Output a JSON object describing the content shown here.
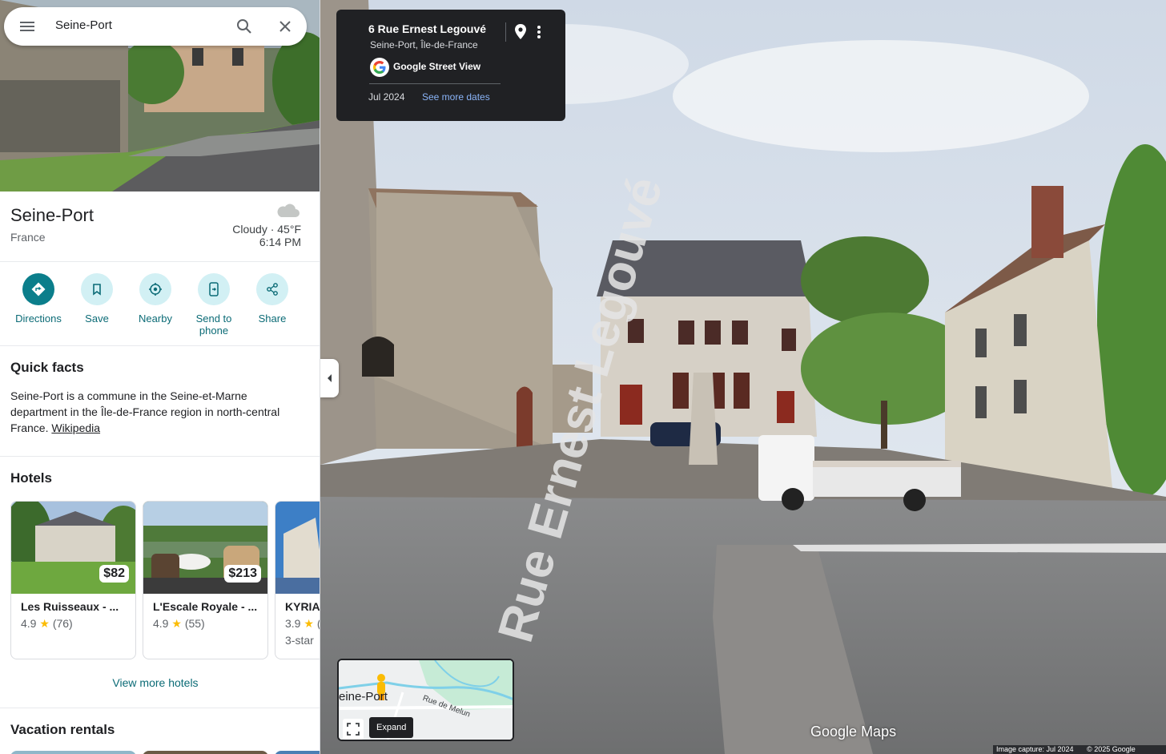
{
  "search": {
    "query": "Seine-Port"
  },
  "place": {
    "name": "Seine-Port",
    "country": "France",
    "weather": {
      "condition_temp": "Cloudy · 45°F",
      "time": "6:14 PM",
      "icon": "cloud-icon"
    }
  },
  "actions": [
    {
      "label": "Directions",
      "icon": "directions-icon"
    },
    {
      "label": "Save",
      "icon": "bookmark-icon"
    },
    {
      "label": "Nearby",
      "icon": "nearby-icon"
    },
    {
      "label": "Send to",
      "label2": "phone",
      "icon": "send-to-phone-icon"
    },
    {
      "label": "Share",
      "icon": "share-icon"
    }
  ],
  "quick_facts": {
    "title": "Quick facts",
    "text": "Seine-Port is a commune in the Seine-et-Marne department in the Île-de-France region in north-central France.",
    "link": "Wikipedia"
  },
  "hotels": {
    "title": "Hotels",
    "items": [
      {
        "name": "Les Ruisseaux - ...",
        "rating": "4.9",
        "reviews": "(76)",
        "price": "$82",
        "class": ""
      },
      {
        "name": "L'Escale Royale - ...",
        "rating": "4.9",
        "reviews": "(55)",
        "price": "$213",
        "class": ""
      },
      {
        "name": "KYRIAD",
        "rating": "3.9",
        "reviews": "(",
        "price": "",
        "class": "3-star"
      }
    ],
    "view_more": "View more hotels"
  },
  "vacation_rentals": {
    "title": "Vacation rentals"
  },
  "street_view": {
    "address": "6 Rue Ernest Legouvé",
    "locality": "Seine-Port, Île-de-France",
    "provider": "Google Street View",
    "date": "Jul 2024",
    "more_dates": "See more dates",
    "street_label": "Rue Ernest Legouvé"
  },
  "minimap": {
    "place": "eine-Port",
    "road": "Rue de Melun",
    "expand_tip": "Expand"
  },
  "footer": {
    "logo_google": "Google",
    "logo_maps": "Maps",
    "capture": "Image capture: Jul 2024",
    "copyright": "© 2025 Google"
  },
  "colors": {
    "accent": "#0b7e8b",
    "accent_light": "#d2f0f4",
    "link_blue": "#8ab4f8",
    "star": "#fbbc04"
  }
}
